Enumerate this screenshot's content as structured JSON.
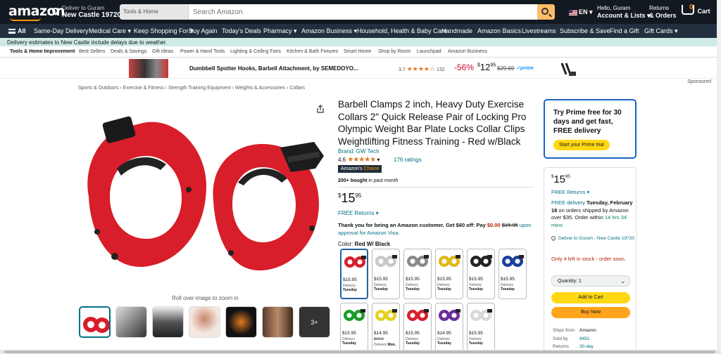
{
  "header": {
    "logo": "amazon",
    "deliver_to": "Deliver to Guram",
    "deliver_city": "New Castle 19720",
    "search_category": "Tools & Home Improvement",
    "search_placeholder": "Search Amazon",
    "lang": "EN",
    "account_greeting": "Hello, Guram",
    "account_label": "Account & Lists",
    "returns_label": "Returns",
    "orders_label": "& Orders",
    "cart_count": "0",
    "cart_label": "Cart"
  },
  "nav": {
    "all": "All",
    "items": [
      "Same-Day Delivery",
      "Medical Care",
      "Keep Shopping For",
      "Buy Again",
      "Today's Deals",
      "Pharmacy",
      "Amazon Business",
      "Household, Health & Baby Care",
      "Handmade",
      "Amazon Basics",
      "Livestreams",
      "Subscribe & Save",
      "Find a Gift",
      "Gift Cards"
    ]
  },
  "banner": "Delivery estimates to New Castle include delays due to weather.",
  "subnav": [
    "Tools & Home Improvement",
    "Best Sellers",
    "Deals & Savings",
    "Gift Ideas",
    "Power & Hand Tools",
    "Lighting & Ceiling Fans",
    "Kitchen & Bath Fixtures",
    "Smart Home",
    "Shop by Room",
    "Launchpad",
    "Amazon Business"
  ],
  "sponsored_ad": {
    "title": "Dumbbell Spotter Hooks, Barbell Attachment, by SEMEDOYO...",
    "rating": "3.7",
    "stars": "★★★★☆",
    "rating_count": "132",
    "discount": "-56%",
    "price_whole": "12",
    "price_frac": "95",
    "list_price": "$29.69",
    "prime": "✓prime",
    "sponsored_label": "Sponsored"
  },
  "breadcrumbs": "Sports & Outdoors › Exercise & Fitness › Strength Training Equipment › Weights & Accessories › Collars",
  "product": {
    "title": "Barbell Clamps 2 inch, Heavy Duty Exercise Collars 2\" Quick Release Pair of Locking Pro Olympic Weight Bar Plate Locks Collar Clips Weightlifting Fitness Training - Red w/Black",
    "brand": "Brand: GW Tech",
    "rating": "4.6",
    "stars": "★★★★★",
    "ratings_count": "176 ratings",
    "choice_prefix": "Amazon's",
    "choice_label": "Choice",
    "bought": "200+ bought",
    "bought_suffix": " in past month",
    "price_symbol": "$",
    "price_whole": "15",
    "price_frac": "95",
    "free_returns": "FREE Returns",
    "promo_a": "Thank you for being an Amazon customer. Get $60 off: Pay ",
    "promo_zero": "$0.00",
    "promo_strike": "$15.95",
    "promo_b": " upon approval for Amazon Visa.",
    "color_label": "Color: ",
    "color_value": "Red W/ Black",
    "zoom_hint": "Roll over image to zoom in",
    "thumb_more": "3+"
  },
  "swatches": [
    {
      "price": "$15.95",
      "del": "Delivery",
      "day": "Tuesday",
      "color": "#d6202d"
    },
    {
      "price": "$15.95",
      "del": "Delivery",
      "day": "Tuesday",
      "color": "#c8c8c8"
    },
    {
      "price": "$15.95",
      "del": "Delivery",
      "day": "Tuesday",
      "color": "#8a8a8a"
    },
    {
      "price": "$15.95",
      "del": "Delivery",
      "day": "Tuesday",
      "color": "#e0b81a"
    },
    {
      "price": "$15.95",
      "del": "Delivery",
      "day": "Tuesday",
      "color": "#222222"
    },
    {
      "price": "$15.95",
      "del": "Delivery",
      "day": "Tuesday",
      "color": "#1c3f9c"
    },
    {
      "price": "$15.95",
      "del": "Delivery",
      "day": "Tuesday",
      "color": "#1a9c2a"
    },
    {
      "price": "$15.95",
      "del": "Delivery",
      "day": "Tuesday",
      "color": "#e4d21e"
    },
    {
      "price": "$15.95",
      "del": "Delivery",
      "day": "Tuesday",
      "color": "#d6202d"
    },
    {
      "price": "$14.95",
      "del": "Delivery",
      "day": "Tuesday",
      "color": "#6a2f9a"
    },
    {
      "price": "$15.95",
      "del": "Delivery",
      "day": "Tuesday",
      "color": "#d8d8d8"
    }
  ],
  "swatch_special": {
    "price": "$14.95",
    "strike": "$16.9",
    "del": "Delivery",
    "day": "Mon,"
  },
  "prime": {
    "text": "Try Prime free for 30 days and get fast, FREE delivery",
    "button": "Start your Prime trial"
  },
  "buybox": {
    "price_symbol": "$",
    "price_whole": "15",
    "price_frac": "95",
    "free_returns": "FREE Returns",
    "delivery_link": "FREE delivery",
    "delivery_date": " Tuesday, February 18",
    "delivery_rest": " on orders shipped by Amazon over $35. Order within ",
    "delivery_time": "14 hrs 34 mins",
    "location": "Deliver to Guram - New Castle 19720",
    "stock": "Only 4 left in stock - order soon.",
    "qty_label": "Quantity: 1",
    "add_to_cart": "Add to Cart",
    "buy_now": "Buy Now",
    "ships_from_label": "Ships from",
    "ships_from": "Amazon",
    "sold_by_label": "Sold by",
    "sold_by": "8451",
    "returns_label": "Returns",
    "returns": "30-day"
  },
  "colors": {
    "accent": "#ff9900",
    "link": "#007185",
    "deal": "#cc0c39",
    "prime_blue": "#1a63c4",
    "cart_yellow": "#ffd814",
    "buy_orange": "#ffa41c"
  }
}
